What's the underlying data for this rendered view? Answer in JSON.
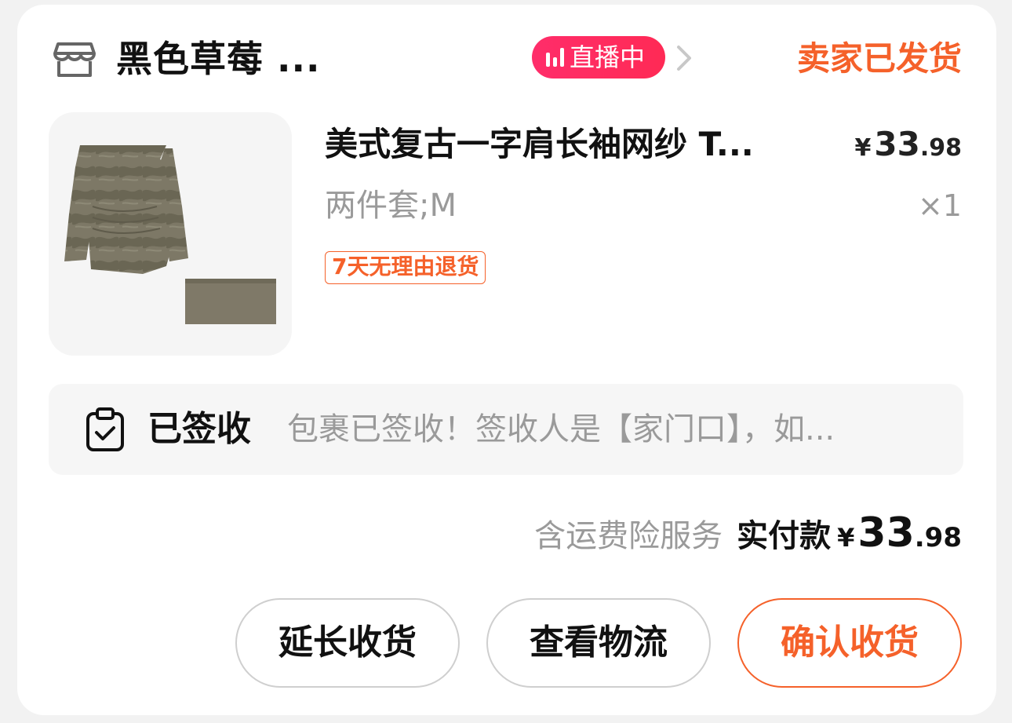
{
  "header": {
    "shop_name": "黑色草莓 ...",
    "live_badge": "直播中",
    "order_status": "卖家已发货"
  },
  "product": {
    "title": "美式复古一字肩长袖网纱 T...",
    "price": {
      "currency": "¥",
      "integer": "33",
      "decimal": ".98"
    },
    "spec": "两件套;M",
    "quantity": "×1",
    "return_tag": "7天无理由退货"
  },
  "logistics": {
    "status": "已签收",
    "detail": "包裹已签收！签收人是【家门口】，如..."
  },
  "summary": {
    "note": "含运费险服务",
    "paid_label": "实付款",
    "total": {
      "currency": "¥",
      "integer": "33",
      "decimal": ".98"
    }
  },
  "actions": {
    "extend_label": "延长收货",
    "track_label": "查看物流",
    "confirm_label": "确认收货"
  },
  "colors": {
    "accent": "#f5612a",
    "live": "#ff2a55",
    "muted": "#9a9a9a"
  },
  "icons": {
    "shop": "shop-icon",
    "live": "live-bars-icon",
    "chevron": "chevron-right-icon",
    "logistics": "clipboard-check-icon"
  }
}
